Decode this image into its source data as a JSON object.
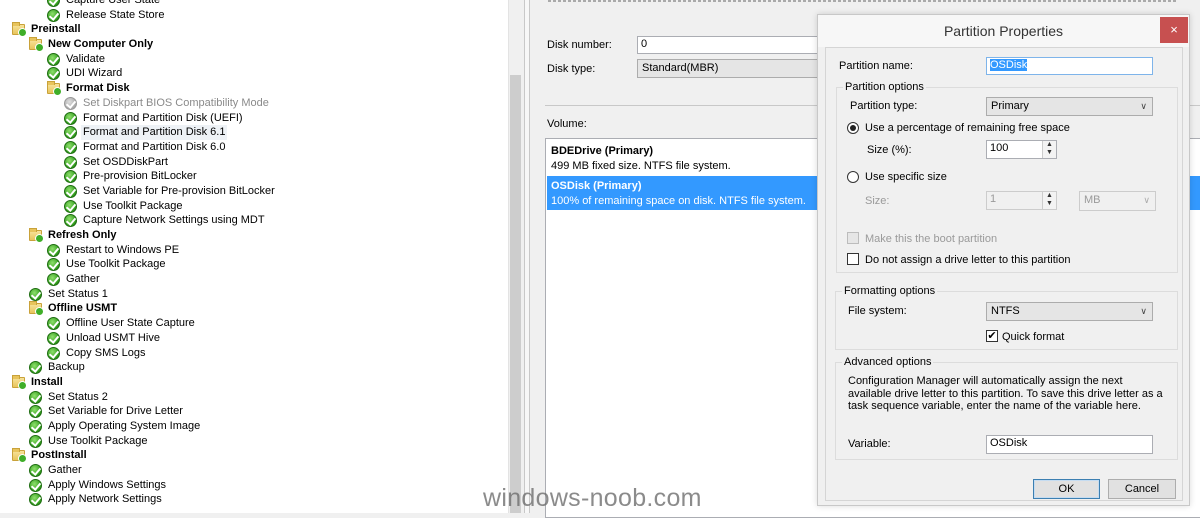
{
  "tree": [
    {
      "label": "Capture User State",
      "level": 2,
      "type": "step"
    },
    {
      "label": "Release State Store",
      "level": 2,
      "type": "step"
    },
    {
      "label": "Preinstall",
      "level": 0,
      "type": "group"
    },
    {
      "label": "New Computer Only",
      "level": 1,
      "type": "group"
    },
    {
      "label": "Validate",
      "level": 2,
      "type": "step"
    },
    {
      "label": "UDI Wizard",
      "level": 2,
      "type": "step"
    },
    {
      "label": "Format Disk",
      "level": 2,
      "type": "group"
    },
    {
      "label": "Set Diskpart BIOS Compatibility Mode",
      "level": 3,
      "type": "disabled"
    },
    {
      "label": "Format and Partition Disk (UEFI)",
      "level": 3,
      "type": "step"
    },
    {
      "label": "Format and Partition Disk 6.1",
      "level": 3,
      "type": "step",
      "hover": true
    },
    {
      "label": "Format and Partition Disk 6.0",
      "level": 3,
      "type": "step"
    },
    {
      "label": "Set OSDDiskPart",
      "level": 3,
      "type": "step"
    },
    {
      "label": "Pre-provision BitLocker",
      "level": 3,
      "type": "step"
    },
    {
      "label": "Set Variable for Pre-provision BitLocker",
      "level": 3,
      "type": "step"
    },
    {
      "label": "Use Toolkit Package",
      "level": 3,
      "type": "step"
    },
    {
      "label": "Capture Network Settings using MDT",
      "level": 3,
      "type": "step"
    },
    {
      "label": "Refresh Only",
      "level": 1,
      "type": "group"
    },
    {
      "label": "Restart to Windows PE",
      "level": 2,
      "type": "step"
    },
    {
      "label": "Use Toolkit Package",
      "level": 2,
      "type": "step"
    },
    {
      "label": "Gather",
      "level": 2,
      "type": "step"
    },
    {
      "label": "Set Status 1",
      "level": 1,
      "type": "step"
    },
    {
      "label": "Offline USMT",
      "level": 1,
      "type": "group"
    },
    {
      "label": "Offline User State Capture",
      "level": 2,
      "type": "step"
    },
    {
      "label": "Unload USMT Hive",
      "level": 2,
      "type": "step"
    },
    {
      "label": "Copy SMS Logs",
      "level": 2,
      "type": "step"
    },
    {
      "label": "Backup",
      "level": 1,
      "type": "step"
    },
    {
      "label": "Install",
      "level": 0,
      "type": "group"
    },
    {
      "label": "Set Status 2",
      "level": 1,
      "type": "step"
    },
    {
      "label": "Set Variable for Drive Letter",
      "level": 1,
      "type": "step"
    },
    {
      "label": "Apply Operating System Image",
      "level": 1,
      "type": "step"
    },
    {
      "label": "Use Toolkit Package",
      "level": 1,
      "type": "step"
    },
    {
      "label": "PostInstall",
      "level": 0,
      "type": "group"
    },
    {
      "label": "Gather",
      "level": 1,
      "type": "step"
    },
    {
      "label": "Apply Windows Settings",
      "level": 1,
      "type": "step"
    },
    {
      "label": "Apply Network Settings",
      "level": 1,
      "type": "step"
    }
  ],
  "disk": {
    "number_label": "Disk number:",
    "number_value": "0",
    "type_label": "Disk type:",
    "type_value": "Standard(MBR)",
    "volume_label": "Volume:",
    "volumes": [
      {
        "title": "BDEDrive (Primary)",
        "desc": "499 MB fixed size. NTFS file system.",
        "selected": false
      },
      {
        "title": "OSDisk (Primary)",
        "desc": "100% of remaining space on disk. NTFS file system.",
        "selected": true
      }
    ]
  },
  "dialog": {
    "title": "Partition Properties",
    "close_icon": "×",
    "name_label": "Partition name:",
    "name_value": "OSDisk",
    "options_legend": "Partition options",
    "type_label": "Partition type:",
    "type_value": "Primary",
    "radio_percent": "Use a percentage of remaining free space",
    "size_pct_label": "Size (%):",
    "size_pct_value": "100",
    "radio_specific": "Use specific size",
    "size_label": "Size:",
    "size_value": "1",
    "size_unit": "MB",
    "boot_label": "Make this the boot partition",
    "no_letter_label": "Do not assign a drive letter to this partition",
    "format_legend": "Formatting options",
    "fs_label": "File system:",
    "fs_value": "NTFS",
    "quick_label": "Quick format",
    "quick_checked": true,
    "advanced_legend": "Advanced options",
    "advanced_text": "Configuration Manager will automatically assign the next available drive letter to this partition. To save this drive letter as a task sequence variable, enter the name of the variable here.",
    "variable_label": "Variable:",
    "variable_value": "OSDisk",
    "ok": "OK",
    "cancel": "Cancel"
  },
  "watermark": "windows-noob.com",
  "colors": {
    "selection": "#3399ff",
    "close": "#c75050"
  }
}
